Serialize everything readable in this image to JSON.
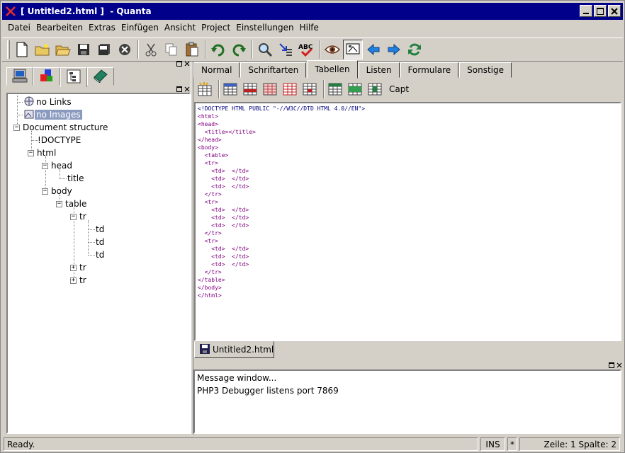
{
  "window": {
    "title": "[ Untitled2.html ]  - Quanta"
  },
  "menu": [
    {
      "label": "Datei"
    },
    {
      "label": "Bearbeiten"
    },
    {
      "label": "Extras"
    },
    {
      "label": "Einfügen"
    },
    {
      "label": "Ansicht"
    },
    {
      "label": "Project"
    },
    {
      "label": "Einstellungen"
    },
    {
      "label": "Hilfe"
    }
  ],
  "tree": {
    "items": [
      {
        "label": "no Links"
      },
      {
        "label": "no Images"
      },
      {
        "label": "Document structure"
      },
      {
        "label": "!DOCTYPE"
      },
      {
        "label": "html"
      },
      {
        "label": "head"
      },
      {
        "label": "title"
      },
      {
        "label": "body"
      },
      {
        "label": "table"
      },
      {
        "label": "tr"
      },
      {
        "label": "td"
      },
      {
        "label": "td"
      },
      {
        "label": "td"
      },
      {
        "label": "tr"
      },
      {
        "label": "tr"
      }
    ]
  },
  "tabs": [
    {
      "label": "Normal"
    },
    {
      "label": "Schriftarten"
    },
    {
      "label": "Tabellen"
    },
    {
      "label": "Listen"
    },
    {
      "label": "Formulare"
    },
    {
      "label": "Sonstige"
    }
  ],
  "table_toolbar": {
    "capt_label": "Capt"
  },
  "editor": {
    "lines": [
      "<!DOCTYPE HTML PUBLIC \"-//W3C//DTD HTML 4.0//EN\">",
      "<html>",
      "<head>",
      "  <title></title>",
      "</head>",
      "<body>",
      "  <table>",
      "  <tr>",
      "    <td>  </td>",
      "    <td>  </td>",
      "    <td>  </td>",
      "  </tr>",
      "  <tr>",
      "    <td>  </td>",
      "    <td>  </td>",
      "    <td>  </td>",
      "  </tr>",
      "  <tr>",
      "    <td>  </td>",
      "    <td>  </td>",
      "    <td>  </td>",
      "  </tr>",
      "</table>",
      "</body>",
      "</html>"
    ]
  },
  "doc_tab": {
    "label": "Untitled2.html"
  },
  "messages": {
    "lines": [
      "Message window...",
      "PHP3 Debugger listens port 7869"
    ]
  },
  "status": {
    "text": "Ready.",
    "mode": "INS",
    "modified": "*",
    "position": "Zeile: 1 Spalte: 2"
  }
}
